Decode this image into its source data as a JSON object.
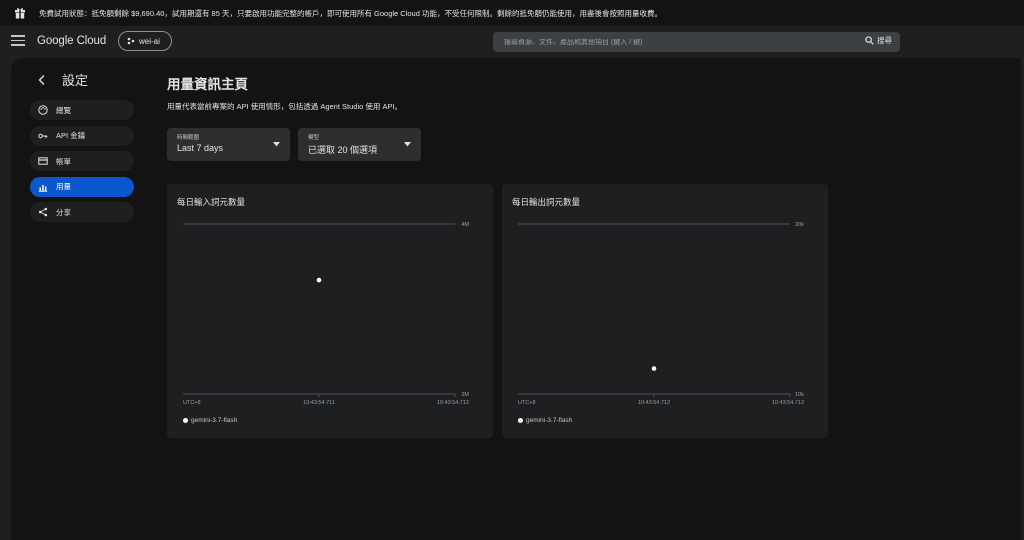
{
  "banner": {
    "text": "免費試用狀態：抵免額剩餘 $9,690.40，試用期還有 85 天，只要啟用功能完整的帳戶，即可使用所有 Google Cloud 功能，不受任何限制。剩餘的抵免額仍能使用，用盡後會按照用量收費。",
    "icon": "gift-icon"
  },
  "header": {
    "logo": "Google Cloud",
    "project": "wei-ai",
    "search_placeholder": "搜尋資源、文件、產品和其他項目 (鍵入 / 鍵)",
    "search_button": "搜尋"
  },
  "settings": {
    "title": "設定",
    "nav": [
      {
        "label": "總覽",
        "icon": "palette-icon",
        "active": false
      },
      {
        "label": "API 金鑰",
        "icon": "key-icon",
        "active": false
      },
      {
        "label": "帳單",
        "icon": "card-icon",
        "active": false
      },
      {
        "label": "用量",
        "icon": "bar-chart-icon",
        "active": true
      },
      {
        "label": "分享",
        "icon": "share-icon",
        "active": false
      }
    ]
  },
  "main": {
    "title": "用量資訊主頁",
    "description": "用量代表當前專案的 API 使用情形，包括透過 Agent Studio 使用 API。",
    "filters": [
      {
        "label": "時間範圍",
        "value": "Last 7 days"
      },
      {
        "label": "模型",
        "value": "已選取 20 個選項"
      }
    ]
  },
  "colors": {
    "accent": "#0b57d0",
    "background": "#131314",
    "card": "#1e1f20"
  },
  "chart_data": [
    {
      "type": "scatter",
      "title": "每日輸入詞元數量",
      "y_ticks": [
        "4M",
        "3M"
      ],
      "ylim": [
        3000000,
        4000000
      ],
      "x_ticks": [
        "UTC+8",
        "10:43:54.711",
        "10:43:54.712"
      ],
      "series": [
        {
          "name": "gemini-3.7-flash",
          "points": [
            {
              "x": "10:43:54.711",
              "y": 3670000
            }
          ]
        }
      ]
    },
    {
      "type": "scatter",
      "title": "每日輸出詞元數量",
      "y_ticks": [
        "20k",
        "10k"
      ],
      "ylim": [
        10000,
        20000
      ],
      "x_ticks": [
        "UTC+8",
        "10:43:54.712",
        "10:43:54.713"
      ],
      "series": [
        {
          "name": "gemini-3.7-flash",
          "points": [
            {
              "x": "10:43:54.712",
              "y": 11500
            }
          ]
        }
      ]
    }
  ]
}
